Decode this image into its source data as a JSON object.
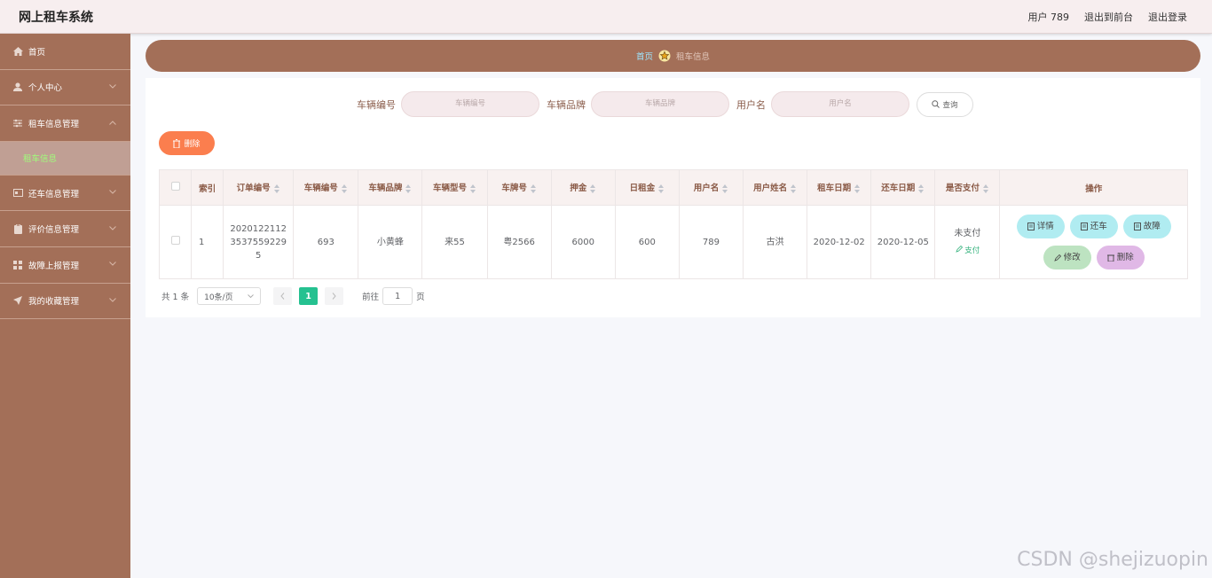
{
  "header": {
    "title": "网上租车系统",
    "user": "用户 789",
    "to_front": "退出到前台",
    "logout": "退出登录"
  },
  "sidebar": {
    "items": [
      {
        "label": "首页"
      },
      {
        "label": "个人中心"
      },
      {
        "label": "租车信息管理"
      },
      {
        "label": "还车信息管理"
      },
      {
        "label": "评价信息管理"
      },
      {
        "label": "故障上报管理"
      },
      {
        "label": "我的收藏管理"
      }
    ],
    "sub_active": "租车信息"
  },
  "breadcrumb": {
    "home": "首页",
    "current": "租车信息"
  },
  "search": {
    "vehicle_no_label": "车辆编号",
    "vehicle_no_placeholder": "车辆编号",
    "brand_label": "车辆品牌",
    "brand_placeholder": "车辆品牌",
    "username_label": "用户名",
    "username_placeholder": "用户名",
    "query_label": "查询"
  },
  "toolbar": {
    "delete_label": "删除"
  },
  "table": {
    "headers": [
      "索引",
      "订单编号",
      "车辆编号",
      "车辆品牌",
      "车辆型号",
      "车牌号",
      "押金",
      "日租金",
      "用户名",
      "用户姓名",
      "租车日期",
      "还车日期",
      "是否支付",
      "操作"
    ],
    "rows": [
      {
        "index": "1",
        "order_no_1": "2020122112",
        "order_no_2": "3537559229",
        "order_no_3": "5",
        "vehicle_no": "693",
        "brand": "小黄蜂",
        "model": "来55",
        "plate": "粤2566",
        "deposit": "6000",
        "daily_rent": "600",
        "username": "789",
        "real_name": "古洪",
        "rent_date": "2020-12-02",
        "return_date": "2020-12-05",
        "paid_status": "未支付",
        "pay_link": "支付"
      }
    ],
    "actions": {
      "detail": "详情",
      "return_car": "还车",
      "fault": "故障",
      "edit": "修改",
      "delete": "删除"
    }
  },
  "pagination": {
    "total": "共 1 条",
    "page_size": "10条/页",
    "current_page": "1",
    "goto_label": "前往",
    "goto_value": "1",
    "page_unit": "页"
  },
  "watermark": "CSDN @shejizuopin",
  "colors": {
    "sidebar": "#a36f58",
    "accent_orange": "#fb7e4e",
    "page_active": "#25c190",
    "btn_cyan": "#b0ecf1",
    "btn_green": "#bde3c1",
    "btn_purple": "#e0b8e6"
  }
}
